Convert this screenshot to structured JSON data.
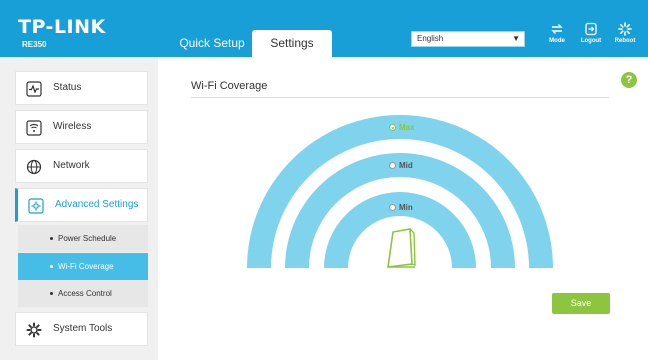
{
  "header": {
    "brand": "TP-LINK",
    "model": "RE350",
    "tabs": [
      {
        "label": "Quick Setup"
      },
      {
        "label": "Settings"
      }
    ],
    "language": "English",
    "actions": [
      {
        "label": "Mode",
        "icon": "mode-icon"
      },
      {
        "label": "Logout",
        "icon": "logout-icon"
      },
      {
        "label": "Reboot",
        "icon": "reboot-icon"
      }
    ]
  },
  "sidebar": {
    "items": [
      {
        "label": "Status",
        "icon": "status-icon"
      },
      {
        "label": "Wireless",
        "icon": "wireless-icon"
      },
      {
        "label": "Network",
        "icon": "network-icon"
      },
      {
        "label": "Advanced Settings",
        "icon": "advanced-settings-icon"
      },
      {
        "label": "System Tools",
        "icon": "system-tools-icon"
      }
    ],
    "subitems": [
      {
        "label": "Power Schedule"
      },
      {
        "label": "Wi-Fi Coverage"
      },
      {
        "label": "Access Control"
      }
    ]
  },
  "main": {
    "title": "Wi-Fi Coverage",
    "levels": [
      {
        "label": "Max"
      },
      {
        "label": "Mid"
      },
      {
        "label": "Min"
      }
    ],
    "selected_level": "Max",
    "save_label": "Save",
    "help": "?"
  },
  "colors": {
    "brand_blue": "#199fd8",
    "arc_blue": "#7fd3ec",
    "accent_green": "#8cc63f"
  }
}
